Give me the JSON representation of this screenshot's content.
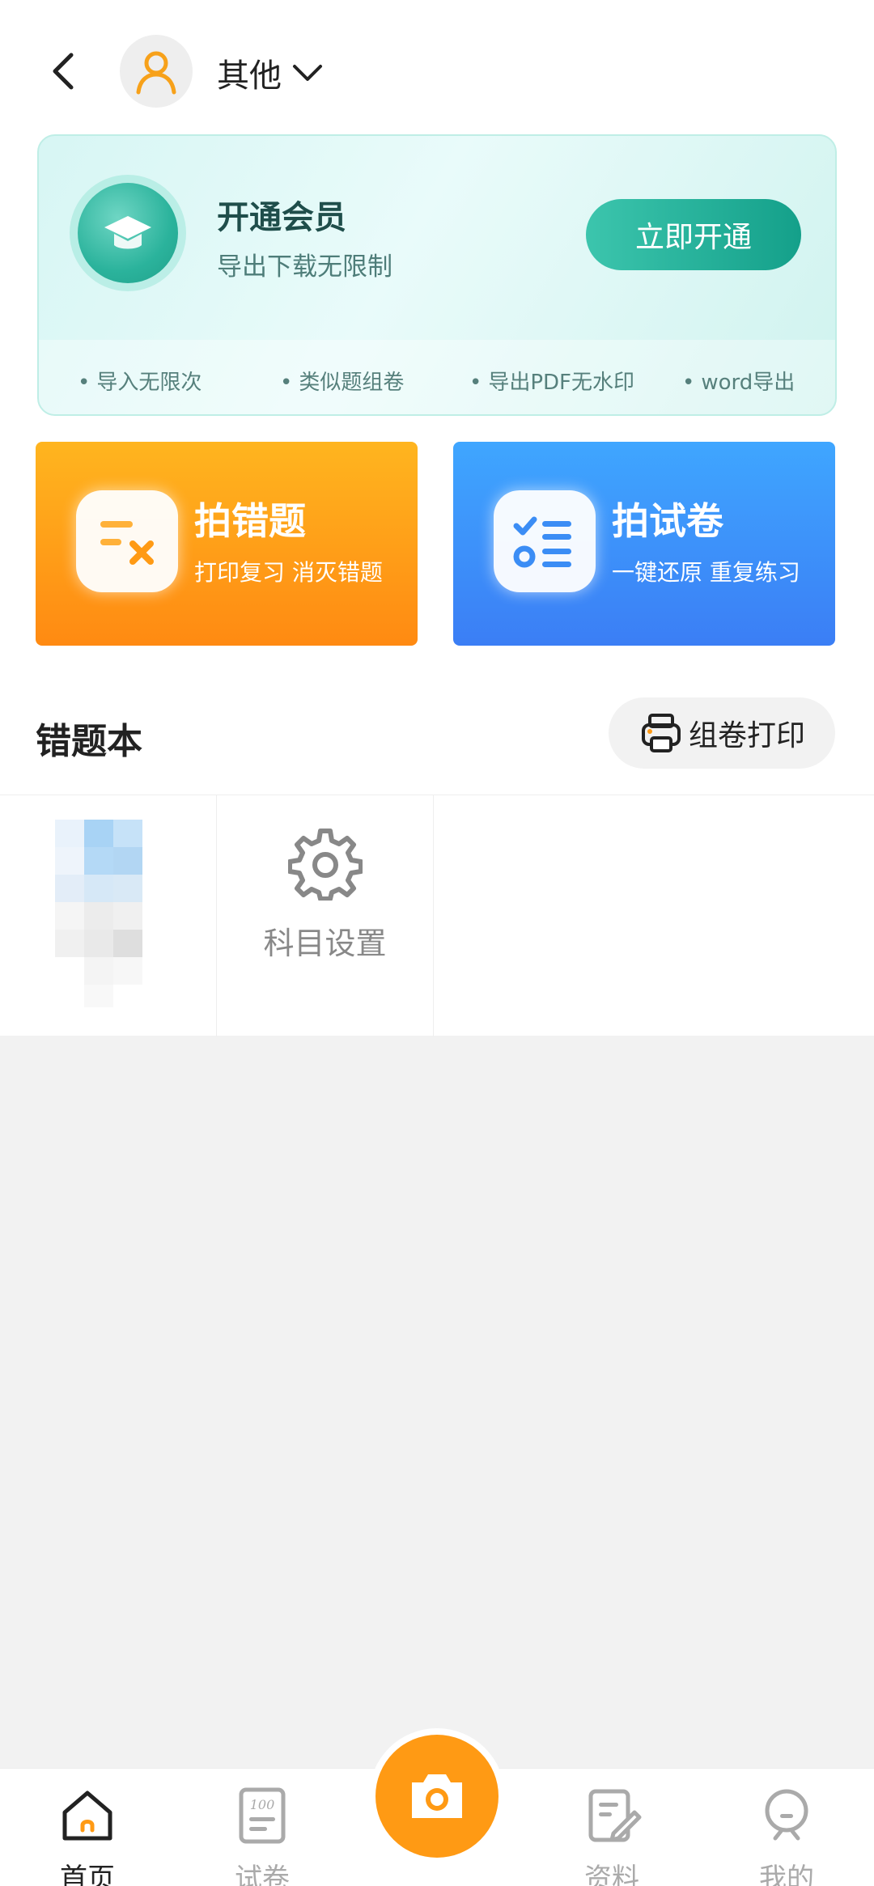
{
  "header": {
    "user_name": "其他"
  },
  "vip": {
    "title": "开通会员",
    "subtitle": "导出下载无限制",
    "button": "立即开通",
    "features": [
      "导入无限次",
      "类似题组卷",
      "导出PDF无水印",
      "word导出"
    ]
  },
  "actions": {
    "wrong": {
      "title": "拍错题",
      "subtitle": "打印复习 消灭错题"
    },
    "paper": {
      "title": "拍试卷",
      "subtitle": "一键还原 重复练习"
    }
  },
  "book": {
    "title": "错题本",
    "print_button": "组卷打印",
    "settings_label": "科目设置"
  },
  "nav": {
    "home": "首页",
    "papers": "试卷",
    "materials": "资料",
    "mine": "我的"
  },
  "colors": {
    "accent_orange": "#ff9a14",
    "teal": "#14a08a",
    "blue": "#3b7ef5"
  }
}
